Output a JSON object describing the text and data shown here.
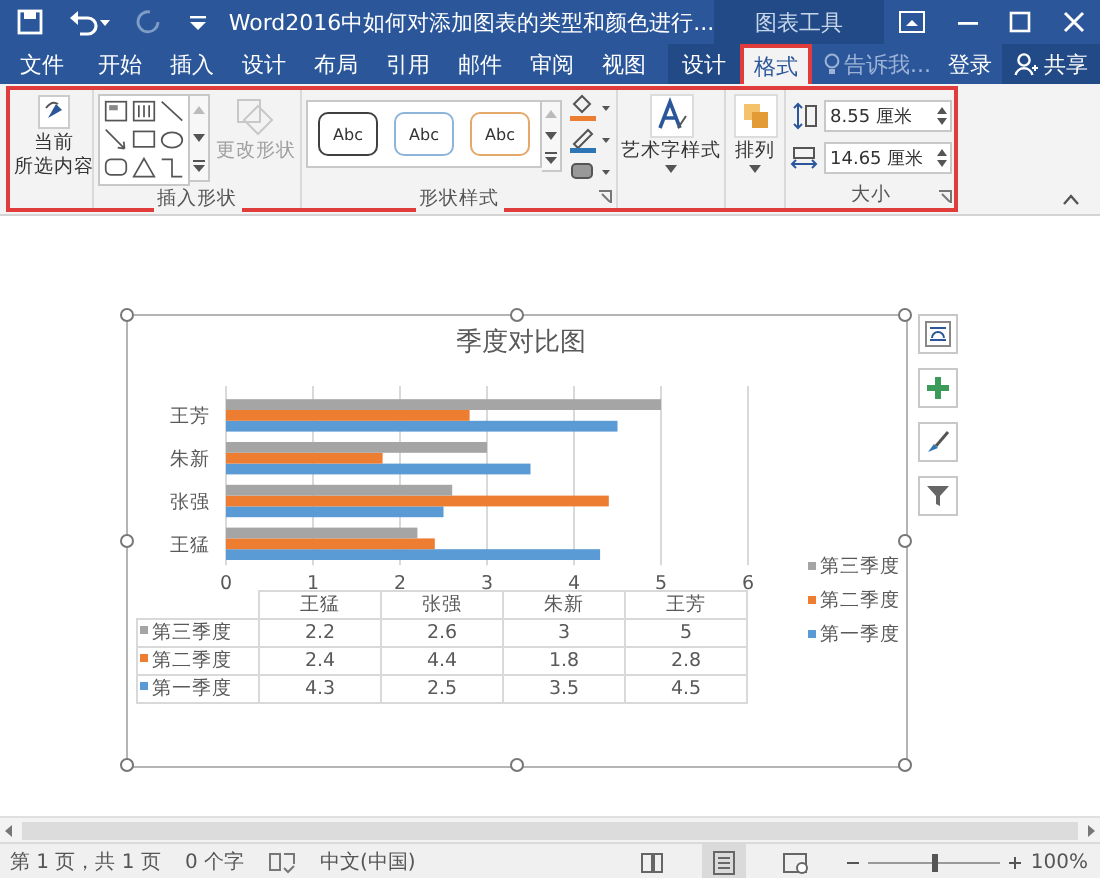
{
  "window": {
    "title": "Word2016中如何对添加图表的类型和颜色进行...",
    "context_group": "图表工具"
  },
  "tabs": [
    {
      "label": "文件",
      "kind": "normal",
      "selected": false,
      "annotated": false
    },
    {
      "label": "开始",
      "kind": "normal",
      "selected": false,
      "annotated": false
    },
    {
      "label": "插入",
      "kind": "normal",
      "selected": false,
      "annotated": false
    },
    {
      "label": "设计",
      "kind": "normal",
      "selected": false,
      "annotated": false
    },
    {
      "label": "布局",
      "kind": "normal",
      "selected": false,
      "annotated": false
    },
    {
      "label": "引用",
      "kind": "normal",
      "selected": false,
      "annotated": false
    },
    {
      "label": "邮件",
      "kind": "normal",
      "selected": false,
      "annotated": false
    },
    {
      "label": "审阅",
      "kind": "normal",
      "selected": false,
      "annotated": false
    },
    {
      "label": "视图",
      "kind": "normal",
      "selected": false,
      "annotated": false
    },
    {
      "label": "设计",
      "kind": "context",
      "selected": false,
      "annotated": false
    },
    {
      "label": "格式",
      "kind": "context",
      "selected": true,
      "annotated": true
    }
  ],
  "tell_me": {
    "placeholder": "告诉我..."
  },
  "sign_in": "登录",
  "share": "共享",
  "ribbon": {
    "annotated": true,
    "selection": {
      "lines": [
        "当前",
        "所选内容"
      ]
    },
    "insert_shapes": {
      "label": "插入形状",
      "change_shape": {
        "label": "更改形状",
        "disabled": true
      }
    },
    "shape_styles": {
      "label": "形状样式",
      "presets": [
        {
          "label": "Abc",
          "color": "#404040"
        },
        {
          "label": "Abc",
          "color": "#8fb4d9"
        },
        {
          "label": "Abc",
          "color": "#e3a86a"
        }
      ]
    },
    "wordart": {
      "label": "艺术字样式"
    },
    "arrange": {
      "label": "排列"
    },
    "size": {
      "label": "大小",
      "height": "8.55 厘米",
      "width": "14.65 厘米"
    }
  },
  "chart": {
    "chart_data": {
      "type": "bar",
      "orientation": "horizontal",
      "title": "季度对比图",
      "categories": [
        "王芳",
        "朱新",
        "张强",
        "王猛"
      ],
      "xticks": [
        0,
        1,
        2,
        3,
        4,
        5,
        6
      ],
      "xlim": [
        0,
        6
      ],
      "grid": true,
      "legend": true,
      "series": [
        {
          "name": "第一季度",
          "color": "#5b9bd5",
          "values": [
            4.5,
            3.5,
            2.5,
            4.3
          ]
        },
        {
          "name": "第二季度",
          "color": "#ed7d31",
          "values": [
            2.8,
            1.8,
            4.4,
            2.4
          ]
        },
        {
          "name": "第三季度",
          "color": "#a5a5a5",
          "values": [
            5,
            3,
            2.6,
            2.2
          ]
        }
      ]
    },
    "data_table": {
      "columns": [
        "王猛",
        "张强",
        "朱新",
        "王芳"
      ],
      "rows": [
        {
          "label": "第三季度",
          "color": "#a5a5a5",
          "cells": [
            "2.2",
            "2.6",
            "3",
            "5"
          ]
        },
        {
          "label": "第二季度",
          "color": "#ed7d31",
          "cells": [
            "2.4",
            "4.4",
            "1.8",
            "2.8"
          ]
        },
        {
          "label": "第一季度",
          "color": "#5b9bd5",
          "cells": [
            "4.3",
            "2.5",
            "3.5",
            "4.5"
          ]
        }
      ]
    }
  },
  "status_bar": {
    "page": "第 1 页，共 1 页",
    "words": "0 个字",
    "language": "中文(中国)",
    "zoom": "100%",
    "zoom_level": {
      "level": 0.5
    }
  }
}
